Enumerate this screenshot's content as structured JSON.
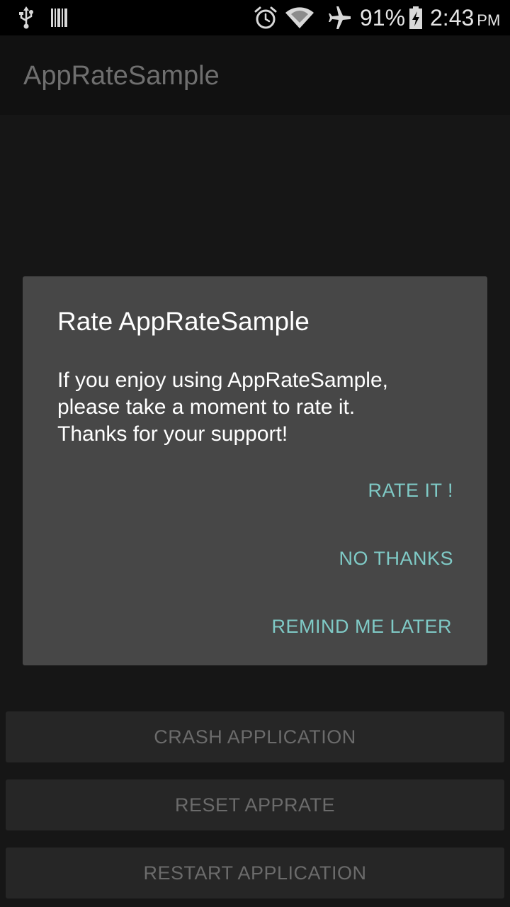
{
  "status_bar": {
    "battery_percent": "91%",
    "time": "2:43",
    "ampm": "PM",
    "icons": [
      "usb-icon",
      "barcode-icon",
      "alarm-clock-icon",
      "wifi-icon",
      "airplane-mode-icon",
      "battery-charging-icon"
    ]
  },
  "action_bar": {
    "title": "AppRateSample"
  },
  "dialog": {
    "title": "Rate AppRateSample",
    "message_lines": [
      "If you enjoy using AppRateSample,",
      "please take a moment to rate it.",
      "Thanks for your support!"
    ],
    "buttons": {
      "rate": "RATE IT !",
      "no_thanks": "NO THANKS",
      "remind": "REMIND ME LATER"
    },
    "accent_color": "#7fcac6"
  },
  "content": {
    "buttons": {
      "crash": "CRASH APPLICATION",
      "reset": "RESET APPRATE",
      "restart": "RESTART APPLICATION"
    }
  }
}
